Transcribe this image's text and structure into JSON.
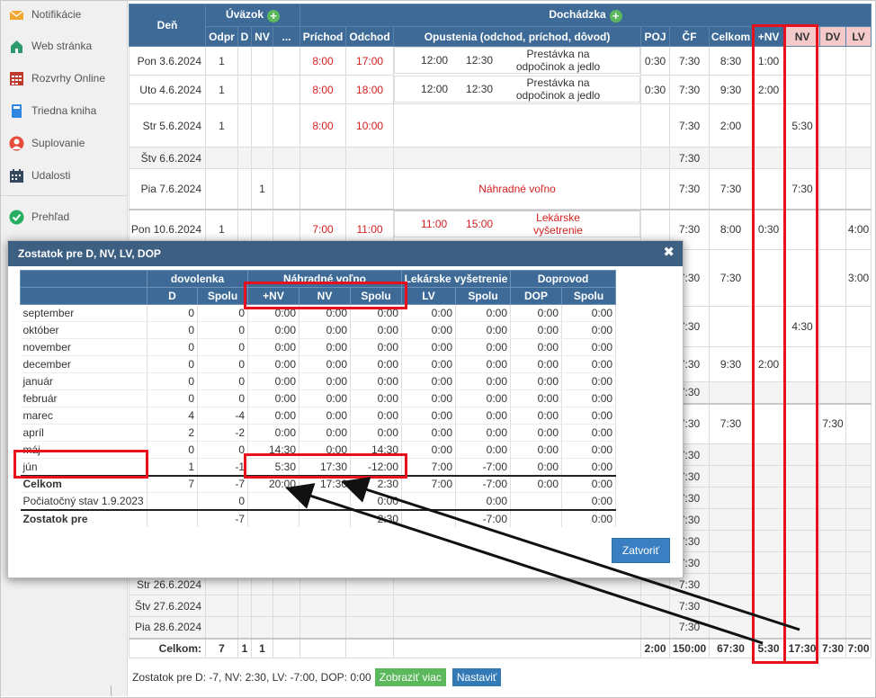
{
  "sidebar": {
    "items": [
      {
        "label": "Notifikácie",
        "icon": "envelope-icon"
      },
      {
        "label": "Web stránka",
        "icon": "house-icon"
      },
      {
        "label": "Rozvrhy Online",
        "icon": "calendar-grid-icon"
      },
      {
        "label": "Triedna kniha",
        "icon": "book-icon"
      },
      {
        "label": "Suplovanie",
        "icon": "person-icon"
      },
      {
        "label": "Udalosti",
        "icon": "calendar-icon"
      },
      {
        "label": "Prehľad",
        "icon": "check-circle-icon"
      }
    ]
  },
  "attendance": {
    "headers": {
      "den": "Deň",
      "uvazok": "Úväzok",
      "dochadzka": "Dochádzka",
      "odpr": "Odpr",
      "d": "D",
      "nv": "NV",
      "more": "...",
      "prichod": "Príchod",
      "odchod": "Odchod",
      "opustenia": "Opustenia (odchod, príchod, dôvod)",
      "poj": "POJ",
      "cf": "ČF",
      "celkom": "Celkom",
      "plusnv": "+NV",
      "nv2": "NV",
      "dv": "DV",
      "lv": "LV"
    },
    "rows": [
      {
        "day": "Pon 3.6.2024",
        "odpr": "1",
        "d": "",
        "nv": "",
        "in": "8:00",
        "out": "17:00",
        "o1": "12:00",
        "o2": "12:30",
        "reason": "Prestávka na odpočinok a jedlo",
        "poj": "0:30",
        "cf": "7:30",
        "celkom": "8:30",
        "pnv": "1:00",
        "nvv": "",
        "dv": "",
        "lv": ""
      },
      {
        "day": "Uto 4.6.2024",
        "odpr": "1",
        "d": "",
        "nv": "",
        "in": "8:00",
        "out": "18:00",
        "o1": "12:00",
        "o2": "12:30",
        "reason": "Prestávka na odpočinok a jedlo",
        "poj": "0:30",
        "cf": "7:30",
        "celkom": "9:30",
        "pnv": "2:00",
        "nvv": "",
        "dv": "",
        "lv": ""
      },
      {
        "day": "Str 5.6.2024",
        "odpr": "1",
        "d": "",
        "nv": "",
        "in": "8:00",
        "out": "10:00",
        "o1": "",
        "o2": "",
        "reason": "",
        "poj": "",
        "cf": "7:30",
        "celkom": "2:00",
        "pnv": "",
        "nvv": "5:30",
        "dv": "",
        "lv": ""
      },
      {
        "day": "Štv 6.6.2024",
        "odpr": "",
        "d": "",
        "nv": "",
        "in": "",
        "out": "",
        "o1": "",
        "o2": "",
        "reason": "",
        "poj": "",
        "cf": "7:30",
        "celkom": "",
        "pnv": "",
        "nvv": "",
        "dv": "",
        "lv": ""
      },
      {
        "day": "Pia 7.6.2024",
        "odpr": "",
        "d": "",
        "nv": "1",
        "in": "",
        "out": "",
        "o1": "",
        "o2": "",
        "reason": "Náhradné voľno",
        "poj": "",
        "cf": "7:30",
        "celkom": "7:30",
        "pnv": "",
        "nvv": "7:30",
        "dv": "",
        "lv": ""
      },
      {
        "day": "Pon 10.6.2024",
        "odpr": "1",
        "d": "",
        "nv": "",
        "in": "7:00",
        "out": "11:00",
        "o1": "11:00",
        "o2": "15:00",
        "reason": "Lekárske vyšetrenie",
        "poj": "",
        "cf": "7:30",
        "celkom": "8:00",
        "pnv": "0:30",
        "nvv": "",
        "dv": "",
        "lv": "4:00"
      },
      {
        "day": "",
        "odpr": "",
        "d": "",
        "nv": "",
        "in": "",
        "out": "",
        "o1": "",
        "o2": "",
        "reason": "",
        "poj": "",
        "cf": "7:30",
        "celkom": "7:30",
        "pnv": "",
        "nvv": "",
        "dv": "",
        "lv": "3:00"
      },
      {
        "day": "",
        "odpr": "",
        "d": "",
        "nv": "",
        "in": "",
        "out": "",
        "o1": "",
        "o2": "",
        "reason": "",
        "poj": "",
        "cf": "7:30",
        "celkom": "",
        "pnv": "",
        "nvv": "4:30",
        "dv": "",
        "lv": ""
      },
      {
        "day": "",
        "odpr": "",
        "d": "",
        "nv": "",
        "in": "",
        "out": "",
        "o1": "",
        "o2": "",
        "reason": "",
        "poj": "",
        "cf": "7:30",
        "celkom": "9:30",
        "pnv": "2:00",
        "nvv": "",
        "dv": "",
        "lv": ""
      },
      {
        "day": "",
        "odpr": "",
        "d": "",
        "nv": "",
        "in": "",
        "out": "",
        "o1": "",
        "o2": "",
        "reason": "",
        "poj": "",
        "cf": "7:30",
        "celkom": "",
        "pnv": "",
        "nvv": "",
        "dv": "",
        "lv": ""
      },
      {
        "day": "",
        "odpr": "",
        "d": "",
        "nv": "",
        "in": "",
        "out": "",
        "o1": "",
        "o2": "",
        "reason": "",
        "poj": "",
        "cf": "7:30",
        "celkom": "7:30",
        "pnv": "",
        "nvv": "",
        "dv": "7:30",
        "lv": ""
      },
      {
        "day": "",
        "odpr": "",
        "d": "",
        "nv": "",
        "in": "",
        "out": "",
        "o1": "",
        "o2": "",
        "reason": "",
        "poj": "",
        "cf": "7:30",
        "celkom": "",
        "pnv": "",
        "nvv": "",
        "dv": "",
        "lv": ""
      },
      {
        "day": "",
        "odpr": "",
        "d": "",
        "nv": "",
        "in": "",
        "out": "",
        "o1": "",
        "o2": "",
        "reason": "",
        "poj": "",
        "cf": "7:30",
        "celkom": "",
        "pnv": "",
        "nvv": "",
        "dv": "",
        "lv": ""
      },
      {
        "day": "",
        "odpr": "",
        "d": "",
        "nv": "",
        "in": "",
        "out": "",
        "o1": "",
        "o2": "",
        "reason": "",
        "poj": "",
        "cf": "7:30",
        "celkom": "",
        "pnv": "",
        "nvv": "",
        "dv": "",
        "lv": ""
      },
      {
        "day": "",
        "odpr": "",
        "d": "",
        "nv": "",
        "in": "",
        "out": "",
        "o1": "",
        "o2": "",
        "reason": "",
        "poj": "",
        "cf": "7:30",
        "celkom": "",
        "pnv": "",
        "nvv": "",
        "dv": "",
        "lv": ""
      },
      {
        "day": "",
        "odpr": "",
        "d": "",
        "nv": "",
        "in": "",
        "out": "",
        "o1": "",
        "o2": "",
        "reason": "",
        "poj": "",
        "cf": "7:30",
        "celkom": "",
        "pnv": "",
        "nvv": "",
        "dv": "",
        "lv": ""
      },
      {
        "day": "",
        "odpr": "",
        "d": "",
        "nv": "",
        "in": "",
        "out": "",
        "o1": "",
        "o2": "",
        "reason": "",
        "poj": "",
        "cf": "7:30",
        "celkom": "",
        "pnv": "",
        "nvv": "",
        "dv": "",
        "lv": ""
      },
      {
        "day": "Str 26.6.2024",
        "odpr": "",
        "d": "",
        "nv": "",
        "in": "",
        "out": "",
        "o1": "",
        "o2": "",
        "reason": "",
        "poj": "",
        "cf": "7:30",
        "celkom": "",
        "pnv": "",
        "nvv": "",
        "dv": "",
        "lv": ""
      },
      {
        "day": "Štv 27.6.2024",
        "odpr": "",
        "d": "",
        "nv": "",
        "in": "",
        "out": "",
        "o1": "",
        "o2": "",
        "reason": "",
        "poj": "",
        "cf": "7:30",
        "celkom": "",
        "pnv": "",
        "nvv": "",
        "dv": "",
        "lv": ""
      },
      {
        "day": "Pia 28.6.2024",
        "odpr": "",
        "d": "",
        "nv": "",
        "in": "",
        "out": "",
        "o1": "",
        "o2": "",
        "reason": "",
        "poj": "",
        "cf": "7:30",
        "celkom": "",
        "pnv": "",
        "nvv": "",
        "dv": "",
        "lv": ""
      }
    ],
    "totals": {
      "label": "Celkom:",
      "odpr": "7",
      "d": "1",
      "nv": "1",
      "poj": "2:00",
      "cf": "150:00",
      "celkom": "67:30",
      "pnv": "5:30",
      "nvv": "17:30",
      "dv": "7:30",
      "lv": "7:00"
    }
  },
  "footer": {
    "summary": "Zostatok pre D: -7, NV: 2:30, LV: -7:00, DOP: 0:00",
    "show_more": "Zobraziť viac",
    "settings": "Nastaviť"
  },
  "modal": {
    "title": "Zostatok pre D, NV, LV, DOP",
    "close_button": "Zatvoriť",
    "groups": {
      "dovolenka": "dovolenka",
      "nahradne": "Náhradné voľno",
      "lekarske": "Lekárske vyšetrenie",
      "doprovod": "Doprovod"
    },
    "cols": [
      "D",
      "Spolu",
      "+NV",
      "NV",
      "Spolu",
      "LV",
      "Spolu",
      "DOP",
      "Spolu"
    ],
    "rows": [
      {
        "month": "september",
        "v": [
          "0",
          "0",
          "0:00",
          "0:00",
          "0:00",
          "0:00",
          "0:00",
          "0:00",
          "0:00"
        ]
      },
      {
        "month": "október",
        "v": [
          "0",
          "0",
          "0:00",
          "0:00",
          "0:00",
          "0:00",
          "0:00",
          "0:00",
          "0:00"
        ]
      },
      {
        "month": "november",
        "v": [
          "0",
          "0",
          "0:00",
          "0:00",
          "0:00",
          "0:00",
          "0:00",
          "0:00",
          "0:00"
        ]
      },
      {
        "month": "december",
        "v": [
          "0",
          "0",
          "0:00",
          "0:00",
          "0:00",
          "0:00",
          "0:00",
          "0:00",
          "0:00"
        ]
      },
      {
        "month": "január",
        "v": [
          "0",
          "0",
          "0:00",
          "0:00",
          "0:00",
          "0:00",
          "0:00",
          "0:00",
          "0:00"
        ]
      },
      {
        "month": "február",
        "v": [
          "0",
          "0",
          "0:00",
          "0:00",
          "0:00",
          "0:00",
          "0:00",
          "0:00",
          "0:00"
        ]
      },
      {
        "month": "marec",
        "v": [
          "4",
          "-4",
          "0:00",
          "0:00",
          "0:00",
          "0:00",
          "0:00",
          "0:00",
          "0:00"
        ]
      },
      {
        "month": "apríl",
        "v": [
          "2",
          "-2",
          "0:00",
          "0:00",
          "0:00",
          "0:00",
          "0:00",
          "0:00",
          "0:00"
        ]
      },
      {
        "month": "máj",
        "v": [
          "0",
          "0",
          "14:30",
          "0:00",
          "14:30",
          "0:00",
          "0:00",
          "0:00",
          "0:00"
        ]
      },
      {
        "month": "jún",
        "v": [
          "1",
          "-1",
          "5:30",
          "17:30",
          "-12:00",
          "7:00",
          "-7:00",
          "0:00",
          "0:00"
        ]
      }
    ],
    "celkom": {
      "label": "Celkom",
      "v": [
        "7",
        "-7",
        "20:00",
        "17:30",
        "2:30",
        "7:00",
        "-7:00",
        "0:00",
        "0:00"
      ]
    },
    "pociatocny": {
      "label": "Počiatočný stav 1.9.2023",
      "v": [
        "",
        "0",
        "",
        "",
        "0:00",
        "",
        "0:00",
        "",
        "0:00"
      ]
    },
    "zostatok": {
      "label": "Zostatok pre",
      "v": [
        "",
        "-7",
        "",
        "",
        "2:30",
        "",
        "-7:00",
        "",
        "0:00"
      ]
    }
  },
  "colors": {
    "header_blue": "#3d6a97",
    "modal_header": "#3d5f82",
    "annotation_red": "#e8101c",
    "time_red": "#d42020"
  }
}
